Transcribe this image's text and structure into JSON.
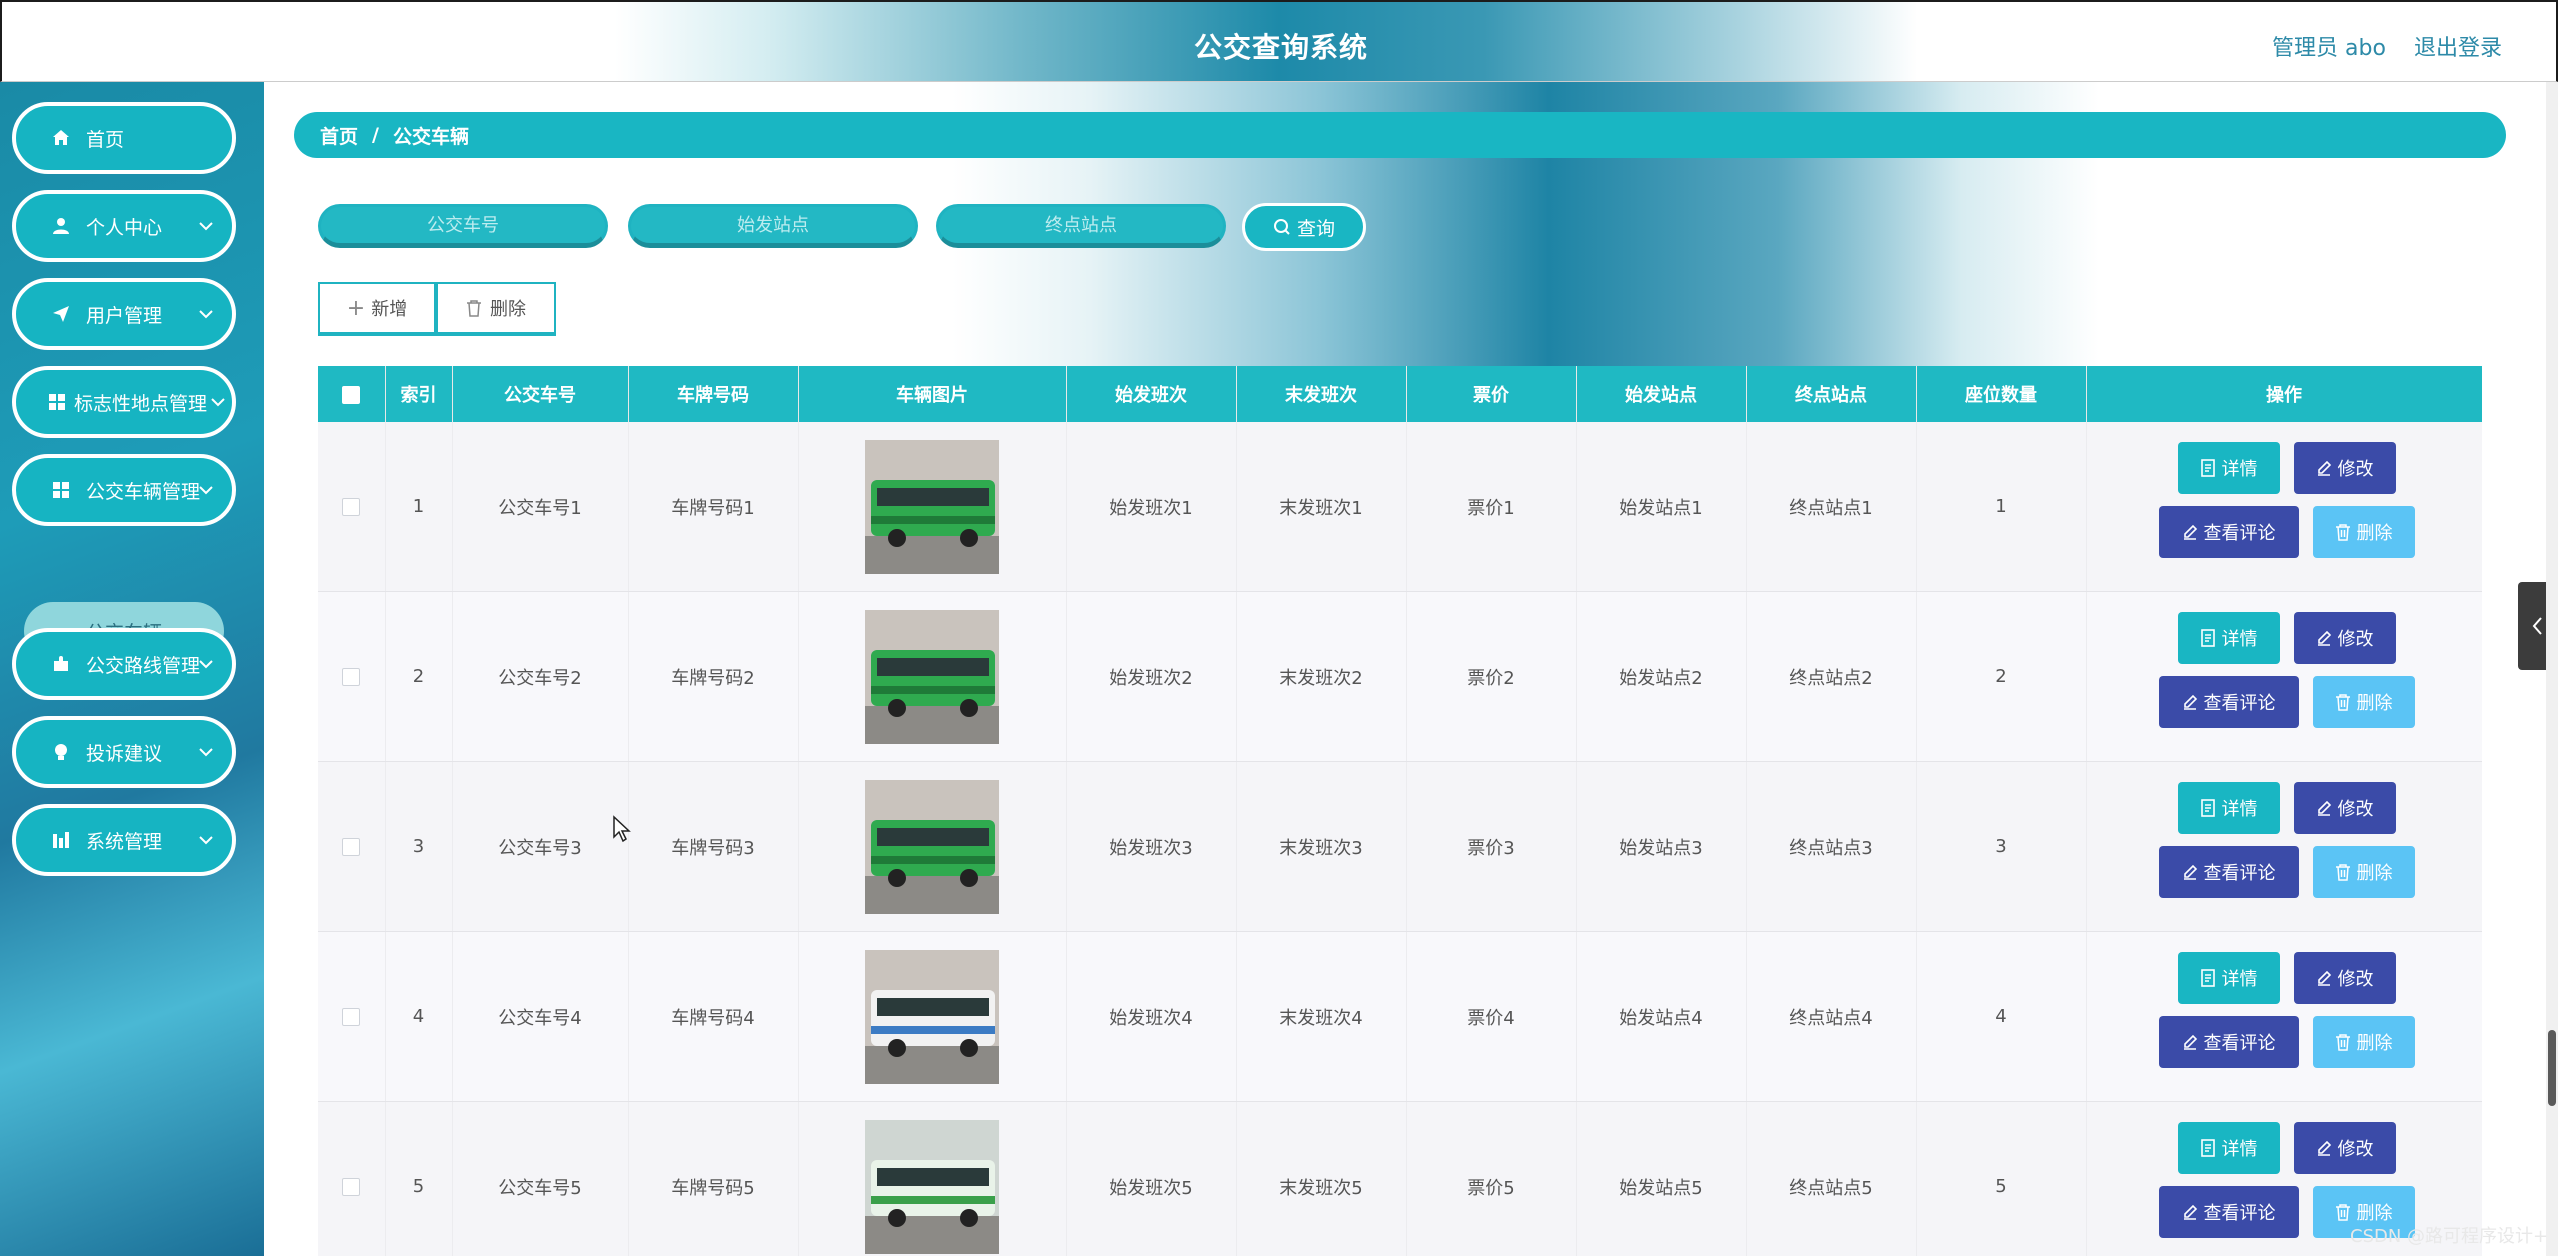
{
  "header": {
    "title": "公交查询系统",
    "admin_label": "管理员 abo",
    "logout_label": "退出登录"
  },
  "sidebar": {
    "items": [
      {
        "label": "首页",
        "icon": "home-icon"
      },
      {
        "label": "个人中心",
        "icon": "user-icon"
      },
      {
        "label": "用户管理",
        "icon": "send-icon"
      },
      {
        "label": "标志性地点管理",
        "icon": "grid-icon"
      },
      {
        "label": "公交车辆管理",
        "icon": "grid-icon"
      },
      {
        "label": "公交路线管理",
        "icon": "puzzle-icon"
      },
      {
        "label": "投诉建议",
        "icon": "bulb-icon"
      },
      {
        "label": "系统管理",
        "icon": "chart-icon"
      }
    ],
    "active_sub": "公交车辆"
  },
  "breadcrumb": {
    "home": "首页",
    "separator": "/",
    "current": "公交车辆"
  },
  "search": {
    "bus_no_placeholder": "公交车号",
    "start_placeholder": "始发站点",
    "end_placeholder": "终点站点",
    "button_label": "查询"
  },
  "toolbar": {
    "add_label": "新增",
    "delete_label": "删除"
  },
  "table": {
    "headers": [
      "索引",
      "公交车号",
      "车牌号码",
      "车辆图片",
      "始发班次",
      "末发班次",
      "票价",
      "始发站点",
      "终点站点",
      "座位数量",
      "操作"
    ],
    "rows": [
      {
        "index": "1",
        "bus_no": "公交车号1",
        "plate": "车牌号码1",
        "first": "始发班次1",
        "last": "末发班次1",
        "price": "票价1",
        "start": "始发站点1",
        "end": "终点站点1",
        "seats": "1",
        "image": "green-bus"
      },
      {
        "index": "2",
        "bus_no": "公交车号2",
        "plate": "车牌号码2",
        "first": "始发班次2",
        "last": "末发班次2",
        "price": "票价2",
        "start": "始发站点2",
        "end": "终点站点2",
        "seats": "2",
        "image": "green-bus"
      },
      {
        "index": "3",
        "bus_no": "公交车号3",
        "plate": "车牌号码3",
        "first": "始发班次3",
        "last": "末发班次3",
        "price": "票价3",
        "start": "始发站点3",
        "end": "终点站点3",
        "seats": "3",
        "image": "green-bus"
      },
      {
        "index": "4",
        "bus_no": "公交车号4",
        "plate": "车牌号码4",
        "first": "始发班次4",
        "last": "末发班次4",
        "price": "票价4",
        "start": "始发站点4",
        "end": "终点站点4",
        "seats": "4",
        "image": "white-bus"
      },
      {
        "index": "5",
        "bus_no": "公交车号5",
        "plate": "车牌号码5",
        "first": "始发班次5",
        "last": "末发班次5",
        "price": "票价5",
        "start": "始发站点5",
        "end": "终点站点5",
        "seats": "5",
        "image": "green-white-bus"
      }
    ],
    "actions": {
      "detail": "详情",
      "edit": "修改",
      "comments": "查看评论",
      "delete": "删除"
    }
  },
  "colors": {
    "primary": "#19b6c3",
    "indigo": "#3b4ba8",
    "light_blue": "#5bc4f5",
    "sidebar_bg": "#1e8fb0"
  },
  "watermark": "CSDN @路可程序设计+"
}
